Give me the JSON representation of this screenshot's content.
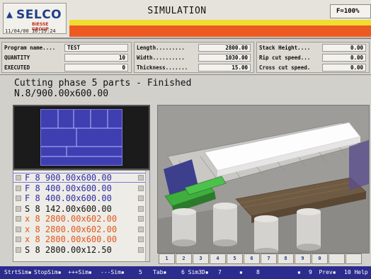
{
  "header": {
    "brand": "SELCO",
    "group": "BIESSE GROUP",
    "datetime": "11/04/00  16:19:24",
    "title": "SIMULATION",
    "function_label": "F=100%"
  },
  "params": {
    "left": [
      {
        "label": "Program name....",
        "value": "TEST"
      },
      {
        "label": "QUANTITY",
        "value": "10"
      },
      {
        "label": "EXECUTED",
        "value": "0"
      }
    ],
    "middle": [
      {
        "label": "Length.........",
        "value": "2800.00"
      },
      {
        "label": "Width..........",
        "value": "1030.00"
      },
      {
        "label": "Thickness.......",
        "value": "15.00"
      }
    ],
    "right": [
      {
        "label": "Stack Height....",
        "value": "0.00"
      },
      {
        "label": "Rip cut speed...",
        "value": "0.00"
      },
      {
        "label": "Cross cut speed.",
        "value": "0.00"
      }
    ]
  },
  "status": {
    "line1": "Cutting phase 5 parts - Finished",
    "line2": "N.8/900.00x600.00"
  },
  "parts": [
    {
      "text": "F 8 900.00x600.00",
      "color": "#2c2ca8"
    },
    {
      "text": "F 8 400.00x600.00",
      "color": "#2c2ca8"
    },
    {
      "text": "F 8 400.00x600.00",
      "color": "#2c2ca8"
    },
    {
      "text": "S 8 142.00x600.00",
      "color": "#111111"
    },
    {
      "text": "x 8 2800.00x602.00",
      "color": "#e0581c"
    },
    {
      "text": "x 8 2800.00x602.00",
      "color": "#e0581c"
    },
    {
      "text": "x 8 2800.00x600.00",
      "color": "#e0581c"
    },
    {
      "text": "S 8 2800.00x12.50",
      "color": "#111111"
    }
  ],
  "toolbar": [
    "1",
    "2",
    "3",
    "4",
    "5",
    "6",
    "7",
    "8",
    "9",
    "0",
    "",
    ""
  ],
  "fkeys": [
    "StrtSim▪",
    "StopSim▪",
    "+++Sim▪",
    "---Sim▪",
    "5",
    "Tab▪",
    "6 Sim3D▪",
    "7",
    "▪",
    "8",
    "▪",
    "9  Prev▪",
    "10 Help"
  ]
}
